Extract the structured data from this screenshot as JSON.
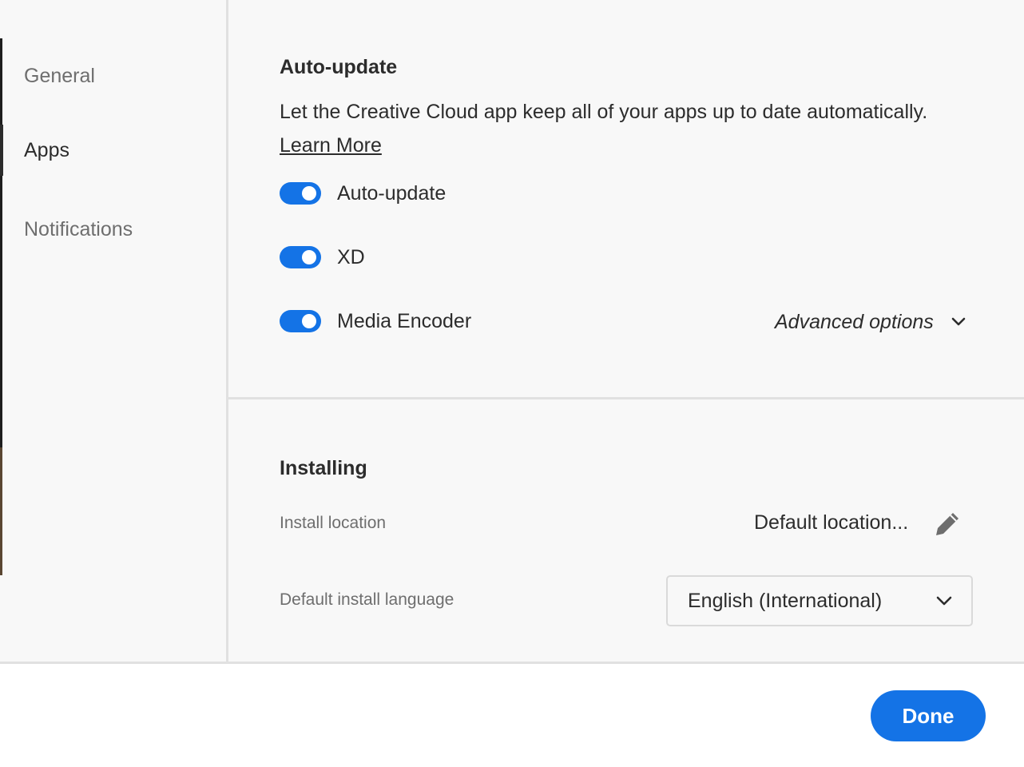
{
  "sidebar": {
    "items": [
      {
        "label": "General",
        "active": false
      },
      {
        "label": "Apps",
        "active": true
      },
      {
        "label": "Notifications",
        "active": false
      }
    ]
  },
  "auto_update": {
    "title": "Auto-update",
    "description": "Let the Creative Cloud app keep all of your apps up to date automatically.",
    "learn_more": "Learn More",
    "toggles": [
      {
        "label": "Auto-update",
        "on": true
      },
      {
        "label": "XD",
        "on": true
      },
      {
        "label": "Media Encoder",
        "on": true
      }
    ],
    "advanced_options": "Advanced options"
  },
  "installing": {
    "title": "Installing",
    "install_location_label": "Install location",
    "install_location_value": "Default location...",
    "language_label": "Default install language",
    "language_value": "English (International)"
  },
  "footer": {
    "done_label": "Done"
  },
  "colors": {
    "accent": "#1473e6",
    "text": "#2c2c2c",
    "muted": "#6e6e6e",
    "divider": "#e1e1e1"
  }
}
